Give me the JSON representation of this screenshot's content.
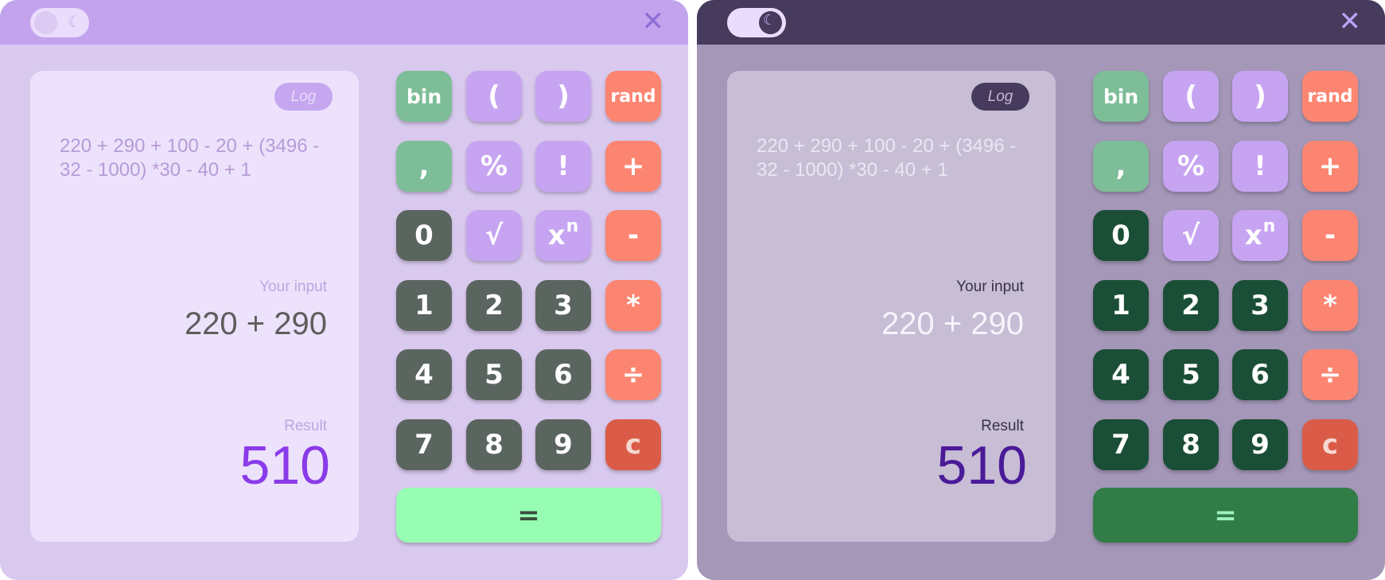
{
  "title_bar": {
    "toggle_icon": "moon-icon",
    "moon_glyph": "☾",
    "close_icon": "close-icon",
    "close_glyph": "✕"
  },
  "display": {
    "log_label": "Log",
    "history_expression": "220 + 290 + 100 - 20 + (3496 - 32 - 1000) *30 - 40 + 1",
    "input_label": "Your input",
    "input_value": "220 + 290",
    "result_label": "Result",
    "result_value": "510"
  },
  "keys": {
    "bin": "bin",
    "lparen": "(",
    "rparen": ")",
    "rand": "rand",
    "comma": ",",
    "percent": "%",
    "factorial": "!",
    "plus": "+",
    "zero": "0",
    "sqrt": "√",
    "power_base": "x",
    "power_exp": "n",
    "minus": "-",
    "one": "1",
    "two": "2",
    "three": "3",
    "multiply": "*",
    "four": "4",
    "five": "5",
    "six": "6",
    "divide": "÷",
    "seven": "7",
    "eight": "8",
    "nine": "9",
    "clear": "c",
    "equals": "="
  },
  "themes": {
    "light": {
      "mode": "light",
      "titlebar": "#c3a3ee",
      "background": "#d9c9ef",
      "number_key": "#5b655f",
      "equals_key": "#97fdb3",
      "result_color": "#8a3be8"
    },
    "dark": {
      "mode": "dark",
      "titlebar": "#463b5d",
      "background": "#a497b8",
      "number_key": "#1b4e36",
      "equals_key": "#327c47",
      "result_color": "#4b1a98"
    }
  }
}
